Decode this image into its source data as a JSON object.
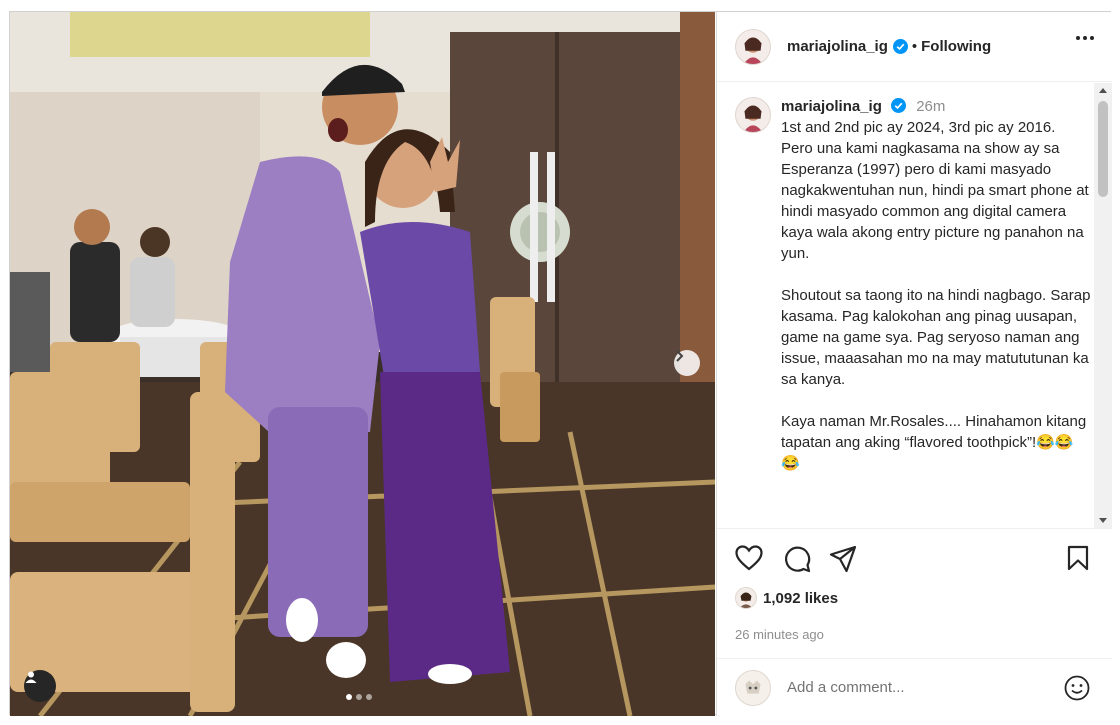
{
  "post": {
    "username": "mariajolina_ig",
    "follow_separator": "•",
    "follow_status": "Following",
    "caption_time": "26m",
    "caption": "1st and 2nd pic ay 2024, 3rd pic ay 2016. Pero una kami nagkasama na show ay sa Esperanza (1997) pero di kami masyado nagkakwentuhan nun, hindi pa smart phone at hindi masyado common ang digital camera kaya wala akong entry picture ng panahon na yun.\n\nShoutout sa taong ito na hindi nagbago. Sarap kasama. Pag kalokohan ang pinag uusapan, game na game sya. Pag seryoso naman ang issue, maaasahan mo na may matututunan ka sa kanya.\n\nKaya naman Mr.Rosales.... Hinahamon kitang tapatan ang aking “flavored toothpick”!😂😂😂",
    "likes": "1,092 likes",
    "posted_ago": "26 minutes ago",
    "carousel": {
      "slide_count": 3,
      "current": 1
    }
  },
  "comment": {
    "placeholder": "Add a comment..."
  },
  "icons": {
    "verified": "verified-badge-icon",
    "more": "more-options-icon",
    "like": "heart-icon",
    "comment": "comment-bubble-icon",
    "share": "send-paper-plane-icon",
    "save": "bookmark-icon",
    "emoji": "emoji-smiley-icon",
    "next": "chevron-right-icon",
    "tag": "user-tag-icon"
  },
  "colors": {
    "verified_blue": "#0095f6",
    "text": "#262626",
    "muted": "#8e8e8e",
    "suit_purple": "#9b7fc2",
    "skirt_purple": "#5b2a86"
  }
}
